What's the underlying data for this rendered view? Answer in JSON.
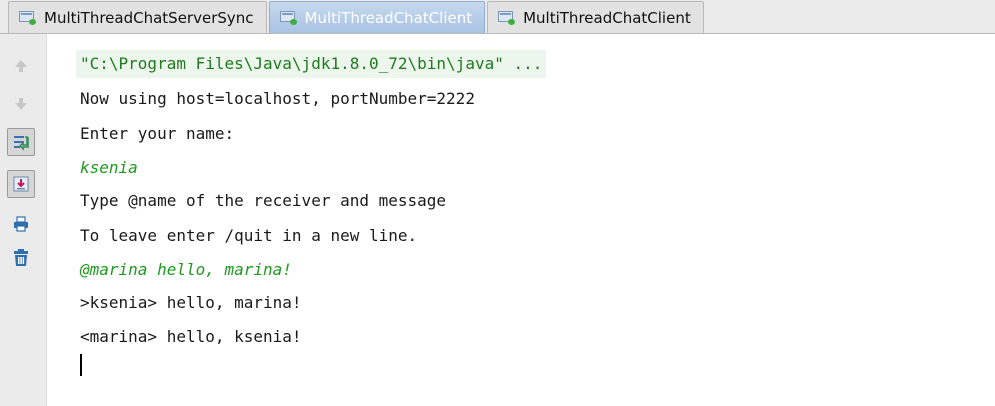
{
  "tabs": [
    {
      "label": "MultiThreadChatServerSync",
      "active": false
    },
    {
      "label": "MultiThreadChatClient",
      "active": true
    },
    {
      "label": "MultiThreadChatClient",
      "active": false
    }
  ],
  "toolbar": {
    "icons": [
      "arrow-up-icon",
      "arrow-down-icon",
      "soft-wrap-icon",
      "scroll-to-end-icon",
      "print-icon",
      "trash-icon"
    ]
  },
  "console": {
    "lines": [
      {
        "text": "\"C:\\Program Files\\Java\\jdk1.8.0_72\\bin\\java\" ...",
        "kind": "command"
      },
      {
        "text": "Now using host=localhost, portNumber=2222",
        "kind": "output"
      },
      {
        "text": "Enter your name:",
        "kind": "output"
      },
      {
        "text": "ksenia",
        "kind": "input"
      },
      {
        "text": "Type @name of the receiver and message",
        "kind": "output"
      },
      {
        "text": "To leave enter /quit in a new line.",
        "kind": "output"
      },
      {
        "text": "@marina hello, marina!",
        "kind": "input"
      },
      {
        "text": ">ksenia> hello, marina!",
        "kind": "output"
      },
      {
        "text": "<marina> hello, ksenia!",
        "kind": "output"
      }
    ]
  },
  "colors": {
    "active_tab": "#a9c3e3",
    "input_text": "#1f9a1f",
    "command_background": "#edf6ec"
  }
}
